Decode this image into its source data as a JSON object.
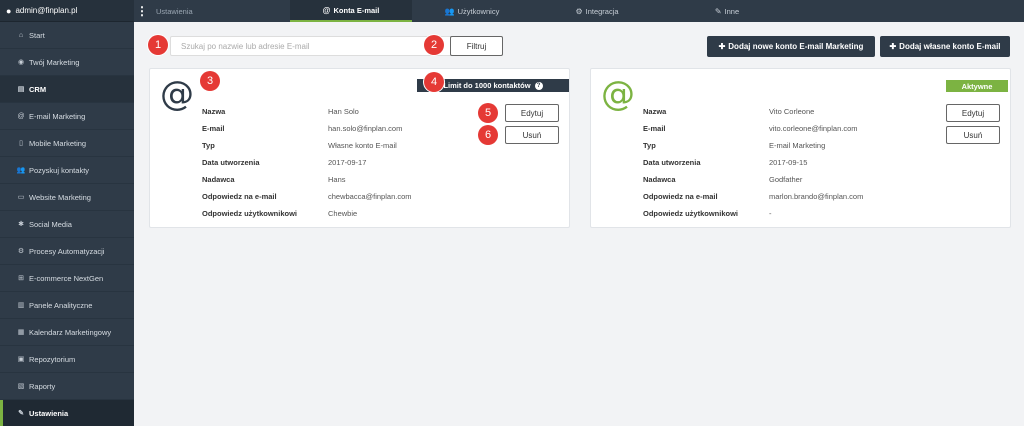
{
  "user": {
    "email": "admin@finplan.pl"
  },
  "sidebar": {
    "items": [
      {
        "label": "Start",
        "icon": "home-icon",
        "glyph": "⌂"
      },
      {
        "label": "Twój Marketing",
        "icon": "eye-icon",
        "glyph": "◉"
      },
      {
        "label": "CRM",
        "icon": "crm-icon",
        "glyph": "▤"
      },
      {
        "label": "E-mail Marketing",
        "icon": "at-icon",
        "glyph": "@"
      },
      {
        "label": "Mobile Marketing",
        "icon": "mobile-icon",
        "glyph": "▯"
      },
      {
        "label": "Pozyskuj kontakty",
        "icon": "users-icon",
        "glyph": "👥"
      },
      {
        "label": "Website Marketing",
        "icon": "monitor-icon",
        "glyph": "▭"
      },
      {
        "label": "Social Media",
        "icon": "group-icon",
        "glyph": "✱"
      },
      {
        "label": "Procesy Automatyzacji",
        "icon": "cogs-icon",
        "glyph": "⚙"
      },
      {
        "label": "E-commerce NextGen",
        "icon": "grid-icon",
        "glyph": "⊞"
      },
      {
        "label": "Panele Analityczne",
        "icon": "chart-icon",
        "glyph": "▥"
      },
      {
        "label": "Kalendarz Marketingowy",
        "icon": "calendar-icon",
        "glyph": "▦"
      },
      {
        "label": "Repozytorium",
        "icon": "archive-icon",
        "glyph": "▣"
      },
      {
        "label": "Raporty",
        "icon": "report-icon",
        "glyph": "▧"
      },
      {
        "label": "Ustawienia",
        "icon": "wrench-icon",
        "glyph": "✎"
      }
    ]
  },
  "topbar": {
    "tabs": [
      {
        "label": "Ustawienia"
      },
      {
        "label": "Konta E-mail",
        "glyph": "@"
      },
      {
        "label": "Użytkownicy",
        "glyph": "👥"
      },
      {
        "label": "Integracja",
        "glyph": "⚙"
      },
      {
        "label": "Inne",
        "glyph": "✎"
      }
    ]
  },
  "toolbar": {
    "search_placeholder": "Szukaj po nazwie lub adresie E-mail",
    "filter_label": "Filtruj",
    "add_marketing_label": "Dodaj nowe konto E-mail Marketing",
    "add_own_label": "Dodaj własne konto E-mail"
  },
  "labels": {
    "name": "Nazwa",
    "email": "E-mail",
    "type": "Typ",
    "created": "Data utworzenia",
    "sender": "Nadawca",
    "reply_email": "Odpowiedz na e-mail",
    "reply_user": "Odpowiedz użytkownikowi",
    "edit": "Edytuj",
    "delete": "Usuń"
  },
  "accounts": [
    {
      "name": "Han Solo",
      "email": "han.solo@finplan.com",
      "type": "Własne konto E-mail",
      "created": "2017-09-17",
      "sender": "Hans",
      "reply_email": "chewbacca@finplan.com",
      "reply_user": "Chewbie",
      "limit": "Limit do 1000 kontaktów"
    },
    {
      "name": "Vito Corleone",
      "email": "vito.corleone@finplan.com",
      "type": "E-mail Marketing",
      "created": "2017-09-15",
      "sender": "Godfather",
      "reply_email": "marlon.brando@finplan.com",
      "reply_user": "-",
      "status": "Aktywne"
    }
  ],
  "markers": [
    "1",
    "2",
    "3",
    "4",
    "5",
    "6"
  ],
  "colors": {
    "dark": "#2f3b48",
    "accent": "#7cb342",
    "marker": "#e53935"
  }
}
